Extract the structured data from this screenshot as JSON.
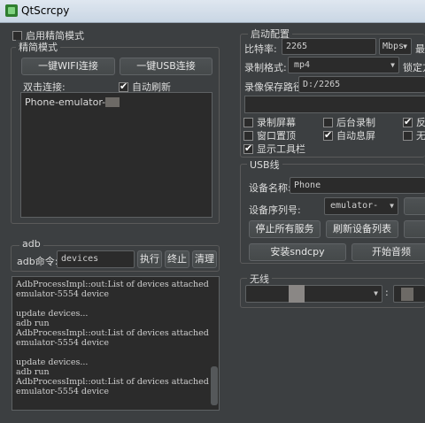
{
  "window": {
    "title": "QtScrcpy"
  },
  "simple_mode": {
    "label": "启用精简模式",
    "checked": false
  },
  "simple_group": {
    "title": "精简模式",
    "wifi_button": "一键WIFI连接",
    "usb_button": "一键USB连接",
    "double_click_label": "双击连接:",
    "auto_refresh": {
      "label": "自动刷新",
      "checked": true
    },
    "devices": [
      "Phone-emulator-"
    ]
  },
  "adb_group": {
    "title": "adb",
    "command_label": "adb命令:",
    "command_value": "devices",
    "execute_button": "执行",
    "terminate_button": "终止",
    "clear_button": "清理"
  },
  "log_lines": [
    "AdbProcessImpl::out:List of devices attached",
    "emulator-5554 device",
    "",
    "update devices...",
    "adb run",
    "AdbProcessImpl::out:List of devices attached",
    "emulator-5554 device",
    "",
    "update devices...",
    "adb run",
    "AdbProcessImpl::out:List of devices attached",
    "emulator-5554 device"
  ],
  "start_config": {
    "title": "启动配置",
    "bitrate_label": "比特率:",
    "bitrate_value": "2265",
    "bitrate_unit": "Mbps",
    "max_size_label_partial": "最",
    "record_format_label": "录制格式:",
    "record_format_value": "mp4",
    "lock_orientation_partial": "锁定方",
    "record_path_label": "录像保存路径",
    "record_path_value": "D:/2265",
    "options": [
      {
        "label": "录制屏幕",
        "checked": false
      },
      {
        "label": "后台录制",
        "checked": false
      },
      {
        "label": "反",
        "checked": true
      },
      {
        "label": "窗口置顶",
        "checked": false
      },
      {
        "label": "自动息屏",
        "checked": true
      },
      {
        "label": "无",
        "checked": false
      },
      {
        "label": "显示工具栏",
        "checked": true
      }
    ]
  },
  "usb_group": {
    "title": "USB线",
    "device_name_label": "设备名称:",
    "device_name_value": "Phone",
    "serial_label": "设备序列号:",
    "serial_value": "emulator-",
    "stop_all_button": "停止所有服务",
    "refresh_button": "刷新设备列表",
    "install_button": "安装sndcpy",
    "audio_button": "开始音频"
  },
  "wireless_group": {
    "title": "无线",
    "separator": ":"
  }
}
